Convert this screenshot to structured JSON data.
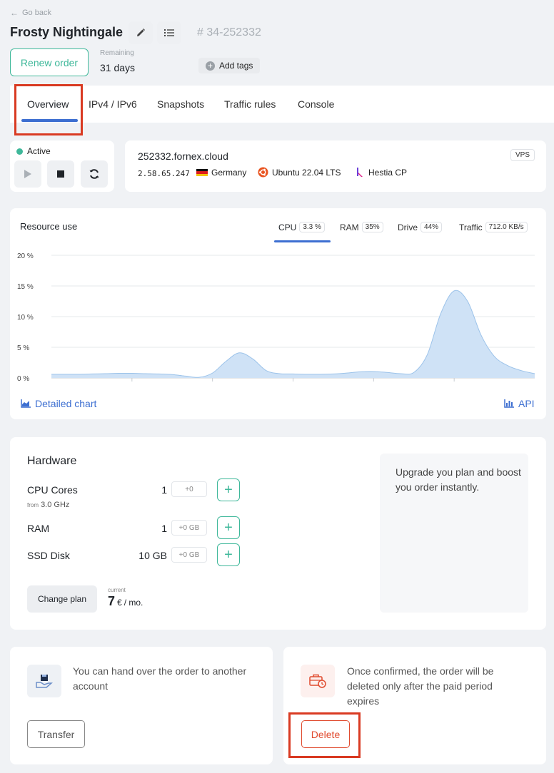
{
  "header": {
    "go_back": "Go back",
    "title": "Frosty Nightingale",
    "order_id": "# 34-252332",
    "renew_label": "Renew order",
    "remaining_label": "Remaining",
    "remaining_value": "31 days",
    "add_tags_label": "Add tags"
  },
  "tabs": [
    {
      "label": "Overview",
      "active": true
    },
    {
      "label": "IPv4 / IPv6",
      "active": false
    },
    {
      "label": "Snapshots",
      "active": false
    },
    {
      "label": "Traffic rules",
      "active": false
    },
    {
      "label": "Console",
      "active": false
    }
  ],
  "power": {
    "status": "Active",
    "status_color": "#3fb89a"
  },
  "server": {
    "hostname": "252332.fornex.cloud",
    "badge": "VPS",
    "ip": "2.58.65.247",
    "country": "Germany",
    "os": "Ubuntu 22.04 LTS",
    "panel": "Hestia CP"
  },
  "resource": {
    "title": "Resource use",
    "metrics": [
      {
        "label": "CPU",
        "value": "3.3 %",
        "active": true
      },
      {
        "label": "RAM",
        "value": "35%",
        "active": false
      },
      {
        "label": "Drive",
        "value": "44%",
        "active": false
      },
      {
        "label": "Traffic",
        "value": "712.0 KB/s",
        "active": false
      }
    ],
    "detailed_chart_label": "Detailed chart",
    "api_label": "API"
  },
  "chart_data": {
    "type": "area",
    "title": "",
    "xlabel": "",
    "ylabel": "",
    "yticks": [
      "20 %",
      "15 %",
      "10 %",
      "5 %",
      "0 %"
    ],
    "ylim": [
      0,
      20
    ],
    "grid": true,
    "x": [
      0,
      1,
      2,
      3,
      4,
      5,
      6,
      7,
      8,
      9,
      10,
      11,
      12,
      13,
      14,
      15,
      16,
      17,
      18,
      19,
      20,
      21,
      22,
      23,
      24,
      25,
      26,
      27,
      28,
      29,
      30,
      31,
      32,
      33,
      34,
      35,
      36
    ],
    "series": [
      {
        "values": [
          0.6,
          0.6,
          0.6,
          0.65,
          0.7,
          0.75,
          0.75,
          0.7,
          0.65,
          0.55,
          0.3,
          0.1,
          0.8,
          2.7,
          4.1,
          3.1,
          1.2,
          0.7,
          0.65,
          0.6,
          0.6,
          0.65,
          0.8,
          1.0,
          1.05,
          0.9,
          0.7,
          0.9,
          3.8,
          10.5,
          14.2,
          12.5,
          7.0,
          3.5,
          2.0,
          1.2,
          0.7
        ],
        "color": "#cfe2f6",
        "stroke": "#9cc3ea"
      }
    ]
  },
  "hardware": {
    "title": "Hardware",
    "rows": [
      {
        "name": "CPU Cores",
        "sub_prefix": "from",
        "sub_value": "3.0 GHz",
        "value": "1",
        "delta": "+0"
      },
      {
        "name": "RAM",
        "sub_prefix": "",
        "sub_value": "",
        "value": "1",
        "delta": "+0 GB"
      },
      {
        "name": "SSD Disk",
        "sub_prefix": "",
        "sub_value": "",
        "value": "10 GB",
        "delta": "+0 GB"
      }
    ],
    "change_plan_label": "Change plan",
    "current_label": "current",
    "price_value": "7",
    "price_unit": "€",
    "price_period": "/ mo.",
    "upgrade_text": "Upgrade you plan and boost you order instantly."
  },
  "transfer": {
    "text": "You can hand over the order to another account",
    "button_label": "Transfer"
  },
  "delete": {
    "text": "Once confirmed, the order will be deleted only after the paid period expires",
    "button_label": "Delete"
  },
  "colors": {
    "accent_green": "#3fb89a",
    "accent_blue": "#3d6fd1",
    "danger": "#e04b2f",
    "highlight": "#d93a22"
  }
}
